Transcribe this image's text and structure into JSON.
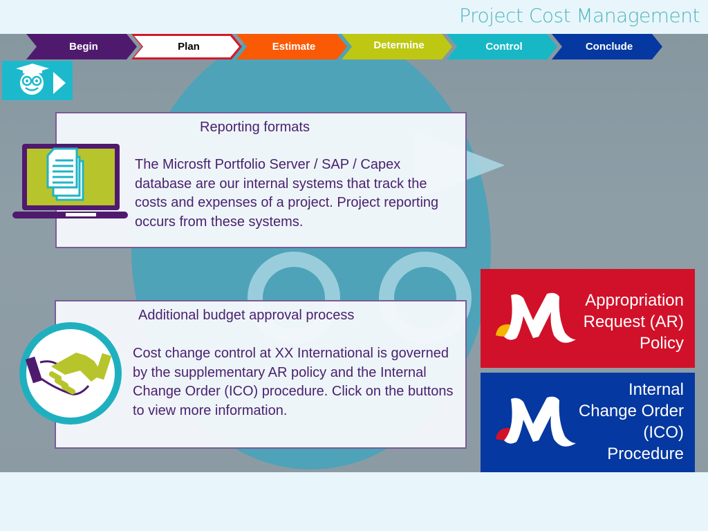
{
  "header": {
    "title": "Project Cost Management"
  },
  "nav": {
    "steps": [
      {
        "label": "Begin",
        "color": "#4f1a6e"
      },
      {
        "label": "Plan",
        "color": "#ffffff",
        "active": true
      },
      {
        "label": "Estimate",
        "color": "#fa5a05"
      },
      {
        "label": "Determine",
        "color": "#bec812"
      },
      {
        "label": "Control",
        "color": "#18b7c6"
      },
      {
        "label": "Conclude",
        "color": "#0538a0"
      }
    ]
  },
  "tutor_button": {
    "icon": "graduate-owl-icon",
    "action_icon": "play-arrow-icon"
  },
  "cards": {
    "reporting": {
      "title": "Reporting formats",
      "body": "The Microsft Portfolio Server / SAP / Capex database are our internal systems that track the costs and expenses of a project. Project reporting occurs from these systems.",
      "icon": "laptop-documents-icon"
    },
    "approval": {
      "title": "Additional budget approval process",
      "body": "Cost change control at XX International is governed by the supplementary AR policy and the Internal Change Order (ICO) procedure. Click on the buttons to view more information.",
      "icon": "handshake-icon"
    }
  },
  "policy_buttons": {
    "ar": {
      "lines": [
        "Appropriation",
        "Request (AR)",
        "Policy"
      ],
      "color": "#d11129",
      "logo_accent": "#f5b400"
    },
    "ico": {
      "lines": [
        "Internal",
        "Change Order",
        "(ICO)",
        "Procedure"
      ],
      "color": "#0538a0",
      "logo_accent": "#d11129"
    }
  }
}
